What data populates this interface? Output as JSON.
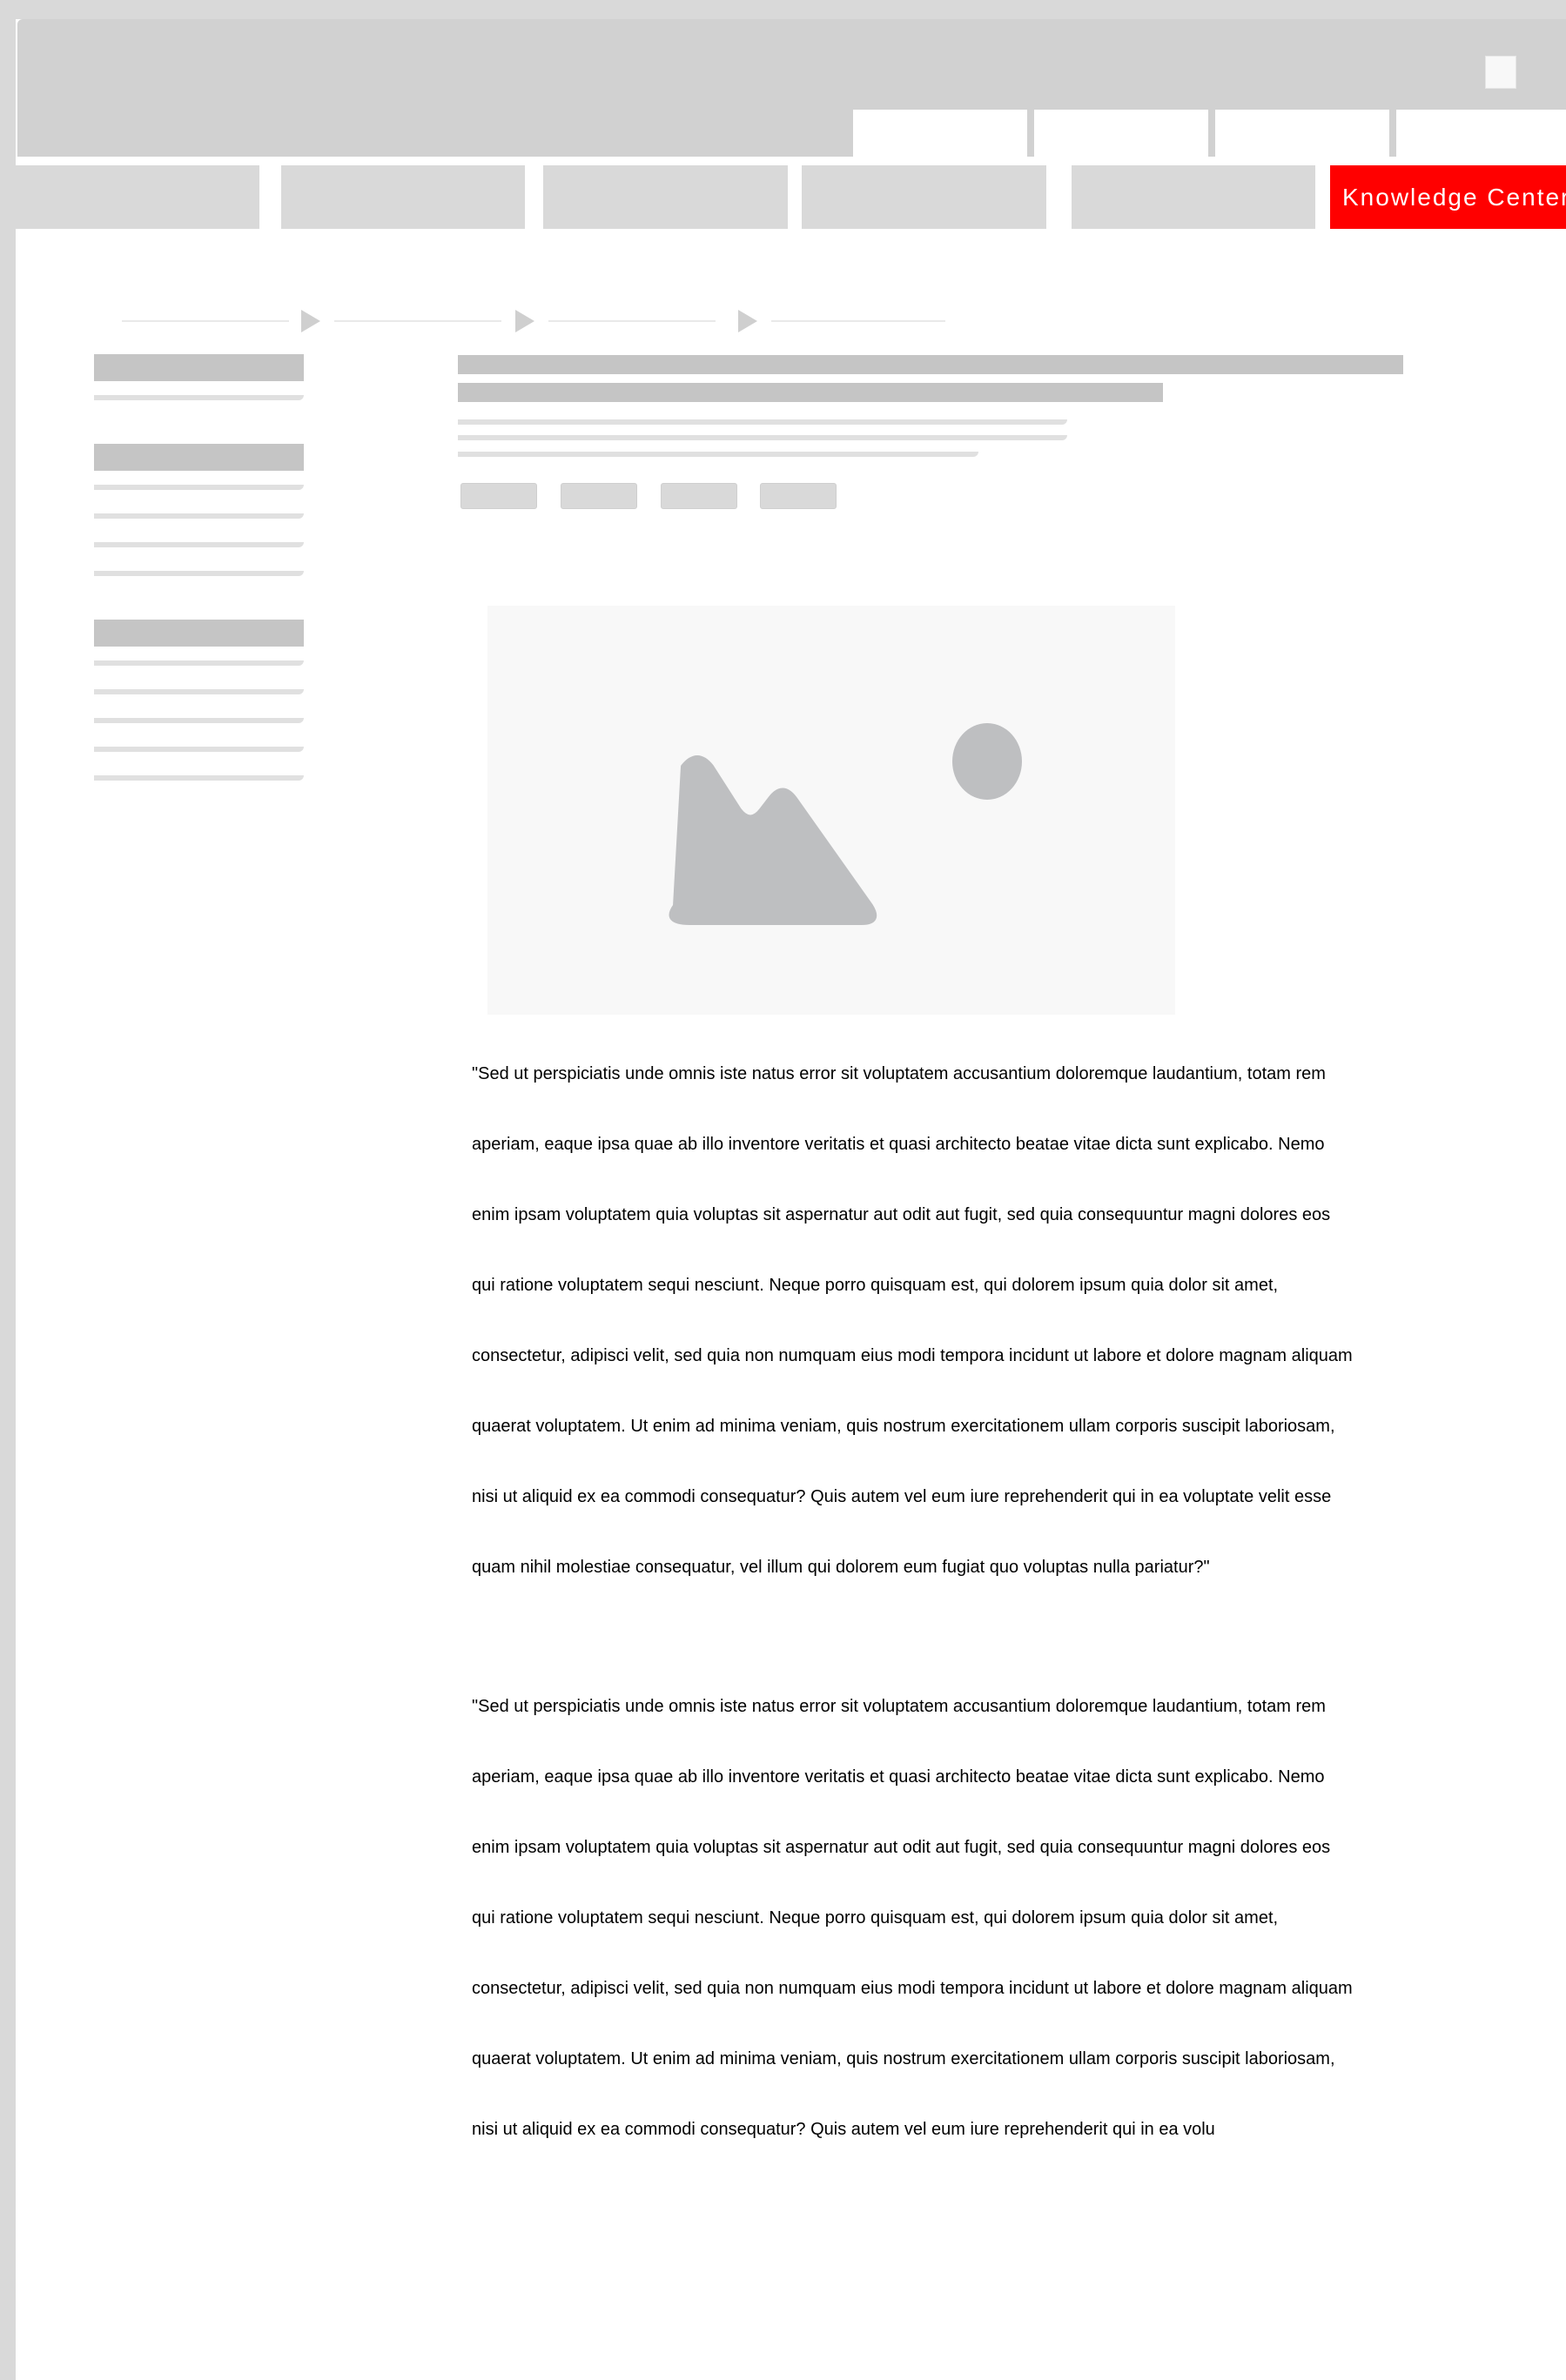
{
  "header": {
    "nav_items": [
      "",
      "",
      "",
      "",
      ""
    ],
    "active_nav_label": "Knowledge Center",
    "active_nav_color": "#ff0000"
  },
  "content": {
    "paragraph_1": [
      "\"Sed ut perspiciatis unde omnis iste natus error sit voluptatem accusantium doloremque laudantium, totam rem",
      "aperiam, eaque ipsa quae ab illo inventore veritatis et quasi architecto beatae vitae dicta sunt explicabo. Nemo",
      "enim ipsam voluptatem quia voluptas sit aspernatur aut odit aut fugit, sed quia consequuntur magni dolores eos",
      "qui ratione voluptatem sequi nesciunt. Neque porro quisquam est, qui dolorem ipsum quia dolor sit amet,",
      "consectetur, adipisci velit, sed quia non numquam eius modi tempora incidunt ut labore et dolore magnam aliquam",
      "quaerat voluptatem. Ut enim ad minima veniam, quis nostrum exercitationem ullam corporis suscipit laboriosam,",
      "nisi ut aliquid ex ea commodi consequatur? Quis autem vel eum iure reprehenderit qui in ea voluptate velit esse",
      "quam nihil molestiae consequatur, vel illum qui dolorem eum fugiat quo voluptas nulla pariatur?\""
    ],
    "paragraph_2": [
      "\"Sed ut perspiciatis unde omnis iste natus error sit voluptatem accusantium doloremque laudantium, totam rem",
      "aperiam, eaque ipsa quae ab illo inventore veritatis et quasi architecto beatae vitae dicta sunt explicabo. Nemo",
      "enim ipsam voluptatem quia voluptas sit aspernatur aut odit aut fugit, sed quia consequuntur magni dolores eos",
      "qui ratione voluptatem sequi nesciunt. Neque porro quisquam est, qui dolorem ipsum quia dolor sit amet,",
      "consectetur, adipisci velit, sed quia non numquam eius modi tempora incidunt ut labore et dolore magnam aliquam",
      "quaerat voluptatem. Ut enim ad minima veniam, quis nostrum exercitationem ullam corporis suscipit laboriosam,",
      "nisi ut aliquid ex ea commodi consequatur? Quis autem vel eum iure reprehenderit qui in ea volu"
    ]
  },
  "icons": {
    "breadcrumb_separator": "play-arrow-icon",
    "hero_image": "image-placeholder-icon"
  }
}
